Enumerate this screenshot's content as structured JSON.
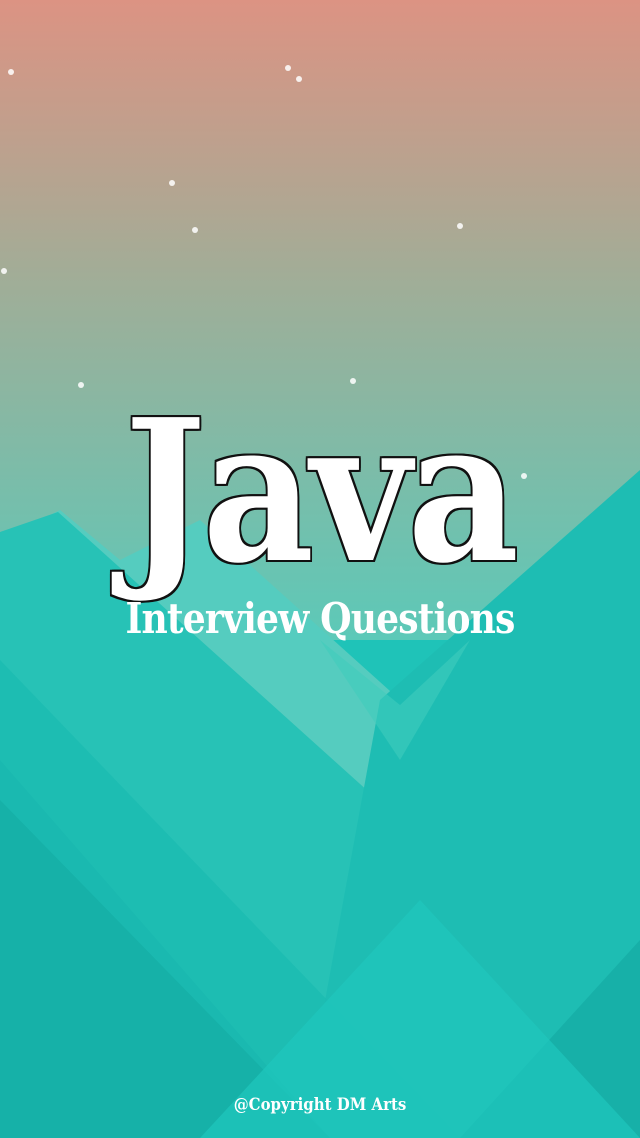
{
  "splash": {
    "title": "Java",
    "subtitle": "Interview Questions",
    "copyright": "@Copyright DM Arts"
  },
  "colors": {
    "sky_top": "#dc9383",
    "sky_bottom": "#5cc9b8",
    "mountain_light": "#4ecfc0",
    "mountain_main": "#1fc3b8",
    "mountain_dark": "#14ada5",
    "text": "#ffffff",
    "title_outline": "#111111"
  }
}
